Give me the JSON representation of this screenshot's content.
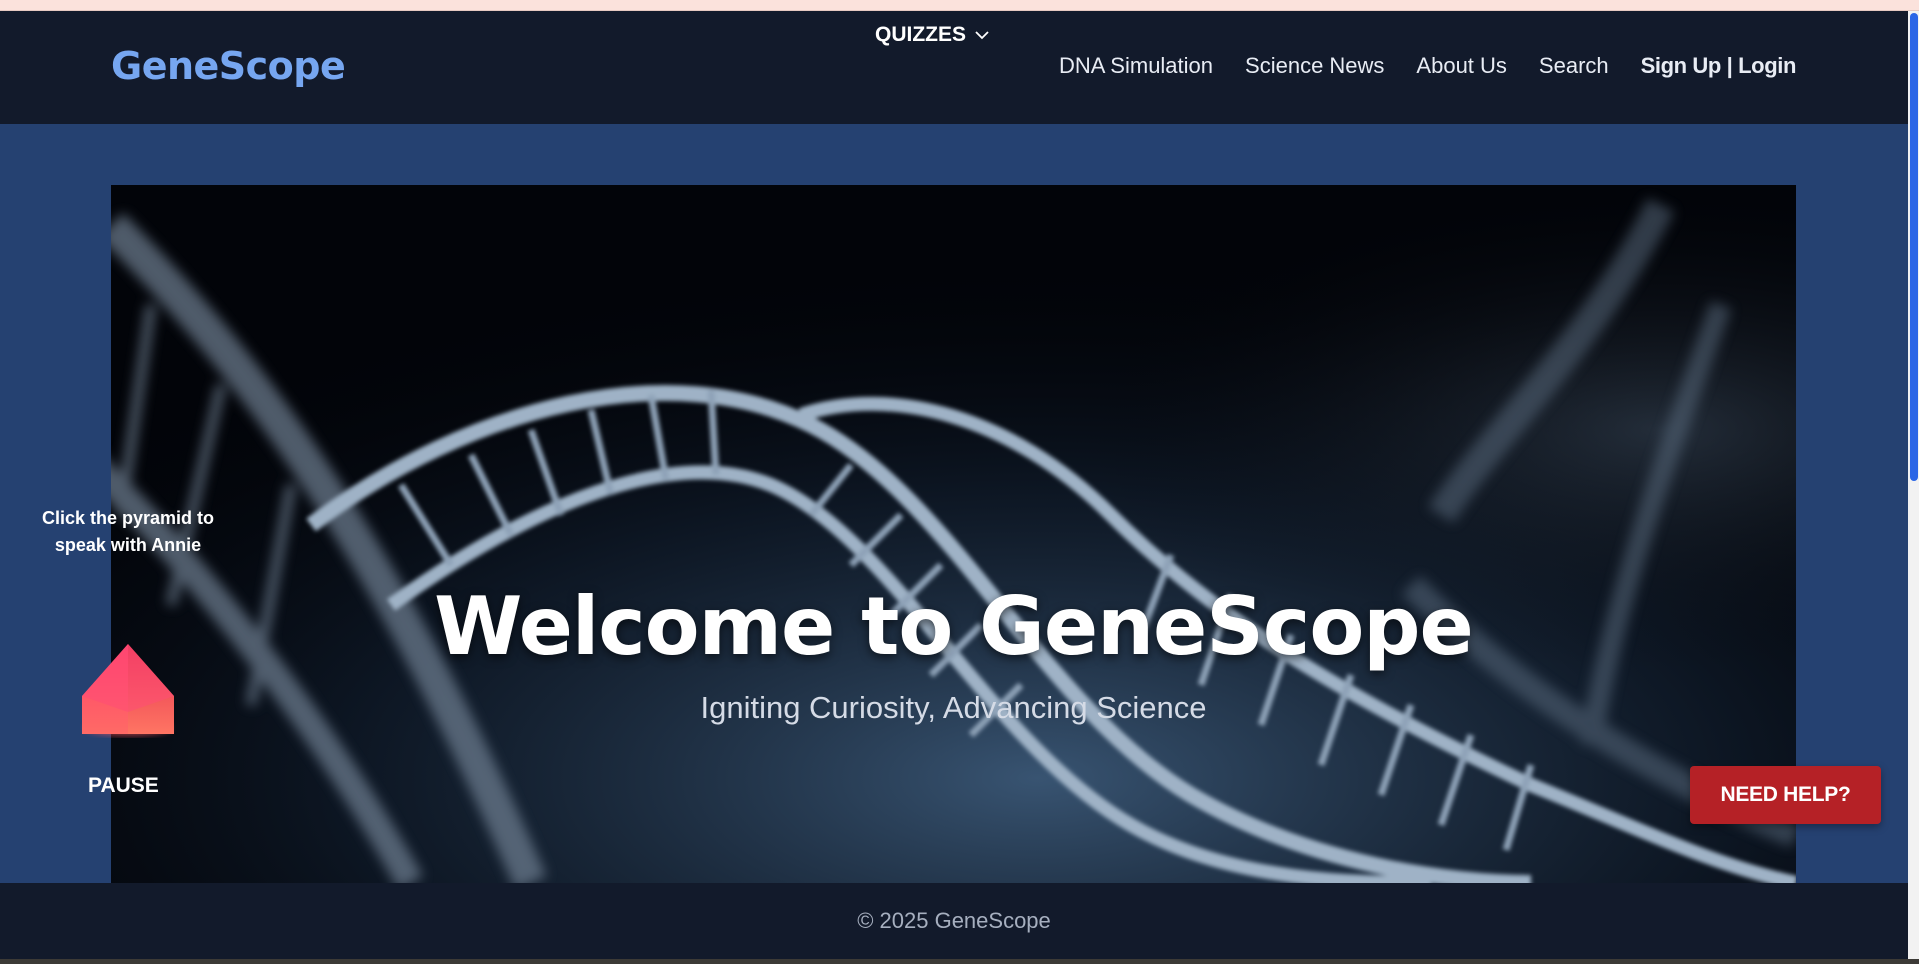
{
  "brand": {
    "logo": "GeneScope"
  },
  "nav": {
    "quizzes": "QUIZZES",
    "links": [
      "DNA Simulation",
      "Science News",
      "About Us",
      "Search"
    ],
    "auth": "Sign Up | Login"
  },
  "hero": {
    "title": "Welcome to GeneScope",
    "subtitle": "Igniting Curiosity, Advancing Science"
  },
  "assistant": {
    "prompt": "Click the pyramid to speak with Annie",
    "pause": "PAUSE"
  },
  "help": {
    "label": "NEED HELP?"
  },
  "footer": {
    "copyright": "© 2025 GeneScope"
  },
  "icons": {
    "quizzes_toggle": "chevron-down-icon",
    "assistant": "pyramid-icon"
  },
  "colors": {
    "navbar": "#121a2b",
    "logo": "#76a6f0",
    "main_bg": "#254171",
    "help_button": "#b52126",
    "pyramid": "#ff4f6e",
    "scrollbar_thumb": "#2b66e6"
  },
  "scroll": {
    "thumb_fraction": 0.49
  }
}
